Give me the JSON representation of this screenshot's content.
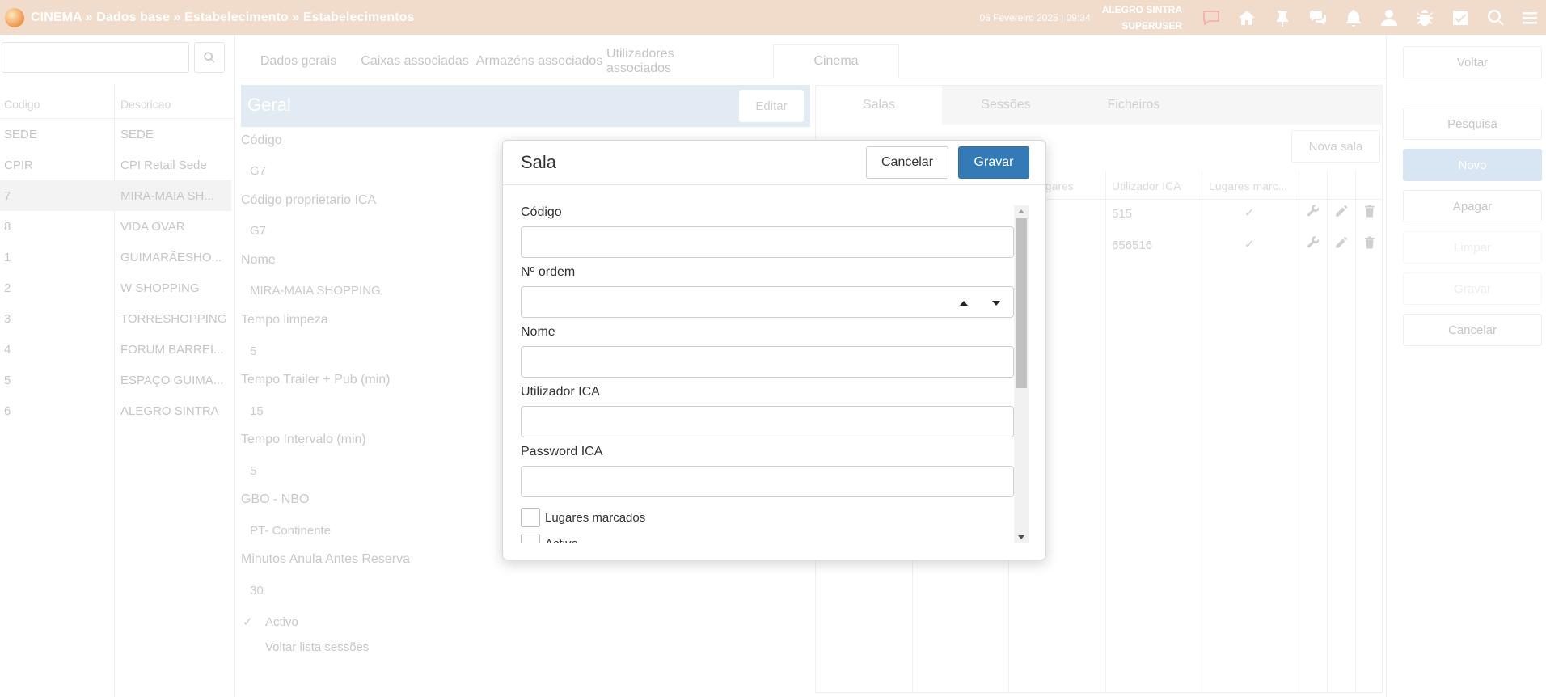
{
  "header": {
    "breadcrumb": "CINEMA » Dados base » Estabelecimento » Estabelecimentos",
    "datetime": "06 Fevereiro 2025 | 09:34",
    "user_line1": "ALEGRO SINTRA",
    "user_line2": "SUPERUSER",
    "icons": [
      "chat-bubble-icon",
      "home-icon",
      "pin-icon",
      "comments-icon",
      "bell-icon",
      "user-icon",
      "bug-icon",
      "checkbox-icon",
      "search-icon",
      "menu-icon"
    ]
  },
  "left_list": {
    "search_placeholder": "",
    "columns": [
      "Codigo",
      "Descricao"
    ],
    "rows": [
      {
        "code": "SEDE",
        "desc": "SEDE"
      },
      {
        "code": "CPIR",
        "desc": "CPI Retail Sede"
      },
      {
        "code": "7",
        "desc": "MIRA-MAIA SH..."
      },
      {
        "code": "8",
        "desc": "VIDA OVAR"
      },
      {
        "code": "1",
        "desc": "GUIMARÃESHO..."
      },
      {
        "code": "2",
        "desc": "W SHOPPING"
      },
      {
        "code": "3",
        "desc": "TORRESHOPPING"
      },
      {
        "code": "4",
        "desc": "FORUM BARREI..."
      },
      {
        "code": "5",
        "desc": "ESPAÇO GUIMA..."
      },
      {
        "code": "6",
        "desc": "ALEGRO SINTRA"
      }
    ]
  },
  "main_tabs": [
    "Dados gerais",
    "Caixas associadas",
    "Armazéns associados",
    "Utilizadores associados",
    "Cinema"
  ],
  "geral": {
    "title": "Geral",
    "edit_label": "Editar",
    "fields": [
      {
        "label": "Código",
        "value": "G7"
      },
      {
        "label": "Código proprietario ICA",
        "value": "G7"
      },
      {
        "label": "Nome",
        "value": "MIRA-MAIA SHOPPING"
      },
      {
        "label": "Tempo limpeza",
        "value": "5"
      },
      {
        "label": "Tempo Trailer + Pub (min)",
        "value": "15"
      },
      {
        "label": "Tempo Intervalo (min)",
        "value": "5"
      },
      {
        "label": "GBO - NBO",
        "value": "PT- Continente"
      },
      {
        "label": "Minutos Anula Antes Reserva",
        "value": "30"
      }
    ],
    "checks": [
      {
        "label": "Activo",
        "checked": true
      },
      {
        "label": "Voltar lista sessões",
        "checked": false
      }
    ]
  },
  "right_panel": {
    "tabs": [
      "Salas",
      "Sessões",
      "Ficheiros"
    ],
    "new_button": "Nova sala",
    "columns": [
      "ugares",
      "Utilizador ICA",
      "Lugares marc..."
    ],
    "rows": [
      {
        "utilizador": "515",
        "marcados": true
      },
      {
        "utilizador": "656516",
        "marcados": true
      }
    ]
  },
  "actions": {
    "back": "Voltar",
    "search": "Pesquisa",
    "new": "Novo",
    "delete": "Apagar",
    "clear": "Limpar",
    "save": "Gravar",
    "cancel": "Cancelar"
  },
  "modal": {
    "title": "Sala",
    "cancel_label": "Cancelar",
    "save_label": "Gravar",
    "fields": [
      {
        "label": "Código",
        "value": ""
      },
      {
        "label": "Nº ordem",
        "value": ""
      },
      {
        "label": "Nome",
        "value": ""
      },
      {
        "label": "Utilizador ICA",
        "value": ""
      },
      {
        "label": "Password ICA",
        "value": ""
      }
    ],
    "checks": [
      {
        "label": "Lugares marcados",
        "checked": false
      },
      {
        "label": "Activo",
        "checked": false
      }
    ]
  },
  "colors": {
    "topbar": "#f1dccc",
    "primary_button": "#337ab7",
    "selected_panel": "#e2ebf4"
  }
}
